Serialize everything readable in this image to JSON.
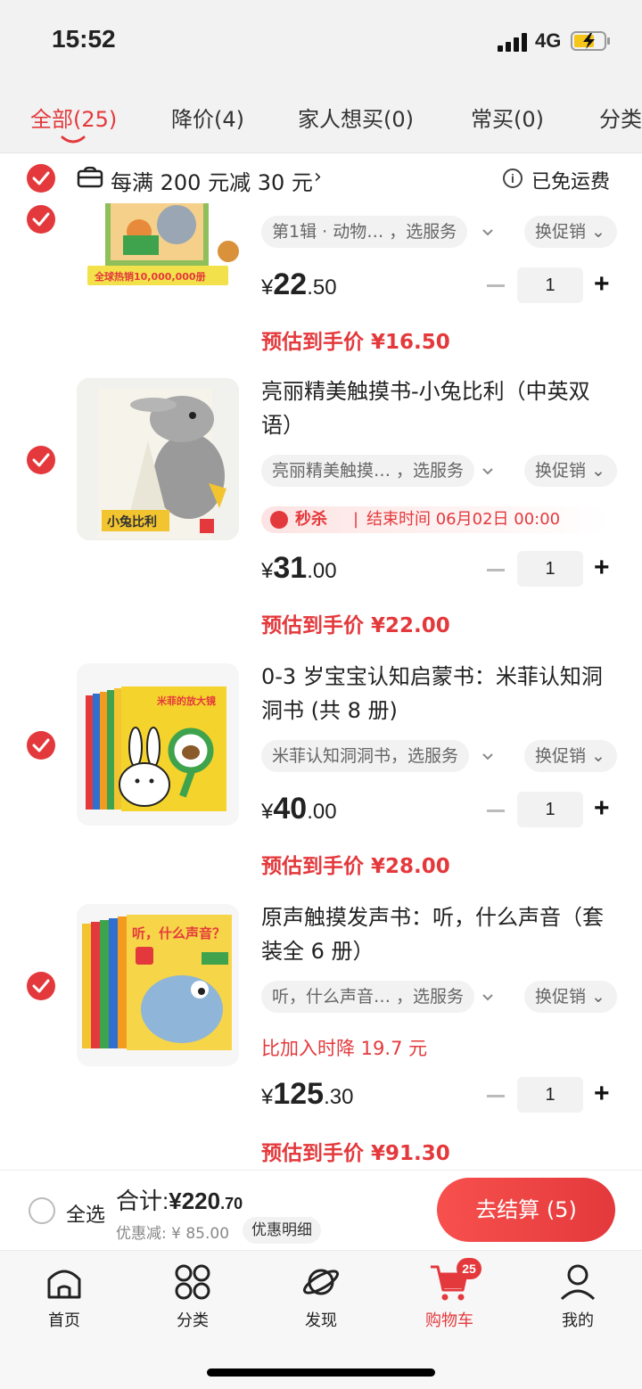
{
  "status": {
    "time": "15:52",
    "network": "4G"
  },
  "tabs": [
    {
      "label": "全部(25)"
    },
    {
      "label": "降价(4)"
    },
    {
      "label": "家人想买(0)"
    },
    {
      "label": "常买(0)"
    },
    {
      "label": "分类"
    }
  ],
  "promo": {
    "text": "每满 200 元减 30 元",
    "shipping": "已免运费"
  },
  "items": [
    {
      "spec": "第1辑 · 动物… ，选服务",
      "promo_select": "换促销",
      "price_int": "22",
      "price_dec": ".50",
      "currency": "¥",
      "qty": "1",
      "estimate": "预估到手价 ¥16.50",
      "cover_text": "全球热销10,000,000册"
    },
    {
      "title": "亮丽精美触摸书-小兔比利（中英双语）",
      "spec": "亮丽精美触摸… ，选服务",
      "promo_select": "换促销",
      "seckill_label": "秒杀",
      "seckill_end": "结束时间 06月02日 00:00",
      "price_int": "31",
      "price_dec": ".00",
      "currency": "¥",
      "qty": "1",
      "estimate": "预估到手价 ¥22.00",
      "cover_text": "小兔比利"
    },
    {
      "title": "0-3 岁宝宝认知启蒙书：米菲认知洞洞书 (共 8 册)",
      "spec": "米菲认知洞洞书，选服务",
      "promo_select": "换促销",
      "price_int": "40",
      "price_dec": ".00",
      "currency": "¥",
      "qty": "1",
      "estimate": "预估到手价 ¥28.00",
      "cover_text": "米菲的放大镜"
    },
    {
      "title": "原声触摸发声书：听，什么声音（套装全 6 册）",
      "spec": "听，什么声音… ，选服务",
      "promo_select": "换促销",
      "price_drop": "比加入时降 19.7 元",
      "price_int": "125",
      "price_dec": ".30",
      "currency": "¥",
      "qty": "1",
      "estimate": "预估到手价 ¥91.30",
      "cover_text": "听，什么声音？"
    }
  ],
  "checkout": {
    "select_all": "全选",
    "total_label": "合计:",
    "total_int": "¥220",
    "total_dec": ".70",
    "discount": "优惠减: ¥ 85.00",
    "detail_button": "优惠明细",
    "checkout_button": "去结算 (5)"
  },
  "nav": [
    {
      "label": "首页"
    },
    {
      "label": "分类"
    },
    {
      "label": "发现"
    },
    {
      "label": "购物车",
      "badge": "25"
    },
    {
      "label": "我的"
    }
  ],
  "colors": {
    "accent": "#e4393c"
  }
}
